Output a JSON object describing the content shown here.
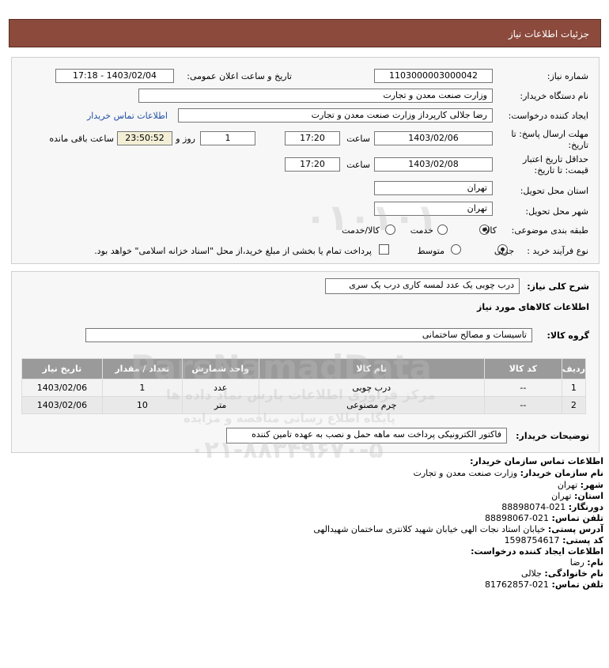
{
  "header": {
    "title": "جزئیات اطلاعات نیاز"
  },
  "form": {
    "need_number_label": "شماره نیاز:",
    "need_number": "1103000003000042",
    "announce_label": "تاریخ و ساعت اعلان عمومی:",
    "announce_value": "1403/02/04 - 17:18",
    "buyer_org_label": "نام دستگاه خریدار:",
    "buyer_org": "وزارت صنعت معدن و تجارت",
    "creator_label": "ایجاد کننده درخواست:",
    "creator": "رضا جلالی کارپرداز وزارت صنعت معدن و تجارت",
    "contact_link": "اطلاعات تماس خریدار",
    "deadline_label_1": "مهلت ارسال پاسخ: تا",
    "deadline_label_2": "تاریخ:",
    "deadline_date": "1403/02/06",
    "time_label": "ساعت",
    "deadline_time": "17:20",
    "days_value": "1",
    "days_label": "روز و",
    "remaining_time": "23:50:52",
    "remaining_label": "ساعت باقی مانده",
    "validity_label_1": "حداقل تاریخ اعتبار",
    "validity_label_2": "قیمت: تا تاریخ:",
    "validity_date": "1403/02/08",
    "validity_time": "17:20",
    "province_label": "استان محل تحویل:",
    "province": "تهران",
    "city_label": "شهر محل تحویل:",
    "city": "تهران",
    "category_label": "طبقه بندی موضوعی:",
    "category_options": [
      "کالا",
      "خدمت",
      "کالا/خدمت"
    ],
    "category_selected": "کالا",
    "process_label": "نوع فرآیند خرید :",
    "process_options": [
      "جزیی",
      "متوسط"
    ],
    "process_selected": "جزیی",
    "treasury_note": "پرداخت تمام یا بخشی از مبلغ خرید،از محل \"اسناد خزانه اسلامی\" خواهد بود."
  },
  "details": {
    "summary_label": "شرح کلی نیاز:",
    "summary": "درب چوبی یک عدد لمسه کاری درب یک سری",
    "goods_info_title": "اطلاعات کالاهای مورد نیاز",
    "goods_group_label": "گروه کالا:",
    "goods_group": "تاسیسات و مصالح ساختمانی",
    "table": {
      "headers": [
        "ردیف",
        "کد کالا",
        "نام کالا",
        "واحد شمارش",
        "تعداد / مقدار",
        "تاریخ نیاز"
      ],
      "rows": [
        [
          "1",
          "--",
          "درب چوبی",
          "عدد",
          "1",
          "1403/02/06"
        ],
        [
          "2",
          "--",
          "چرم مصنوعی",
          "متر",
          "10",
          "1403/02/06"
        ]
      ]
    },
    "buyer_notes_label": "توضیحات خریدار:",
    "buyer_notes": "فاکتور الکترونیکی پرداخت سه ماهه حمل و نصب به عهده تامین کننده"
  },
  "contact": {
    "org_title": "اطلاعات تماس سازمان خریدار:",
    "buyer_name_label": "نام سازمان خریدار:",
    "buyer_name": "وزارت صنعت معدن و تجارت",
    "city_label": "شهر:",
    "city": "تهران",
    "province_label": "استان:",
    "province": "تهران",
    "fax_label": "دورنگار:",
    "fax": "021-88898074",
    "phone_label": "تلفن تماس:",
    "phone": "021-88898067",
    "address_label": "آدرس پستی:",
    "address": "خیابان استاد نجات الهی خیابان شهید کلانتری ساختمان شهیدالهی",
    "postal_label": "کد پستی:",
    "postal": "1598754617",
    "creator_title": "اطلاعات ایجاد کننده درخواست:",
    "first_name_label": "نام:",
    "first_name": "رضا",
    "last_name_label": "نام خانوادگی:",
    "last_name": "جلالی",
    "creator_phone_label": "تلفن تماس:",
    "creator_phone": "021-81762857"
  },
  "watermark": {
    "brand": "ParsNamadData",
    "line1": "مرکز فراوری اطلاعات پارس نماد داده ها",
    "line2": "پایگاه اطلاع رسانی مناقصه و مزایده",
    "phone": "۰۲۱-۸۸۳۴۹۶۷۰-۵",
    "digits": "۰۱۰۱۰۱"
  }
}
